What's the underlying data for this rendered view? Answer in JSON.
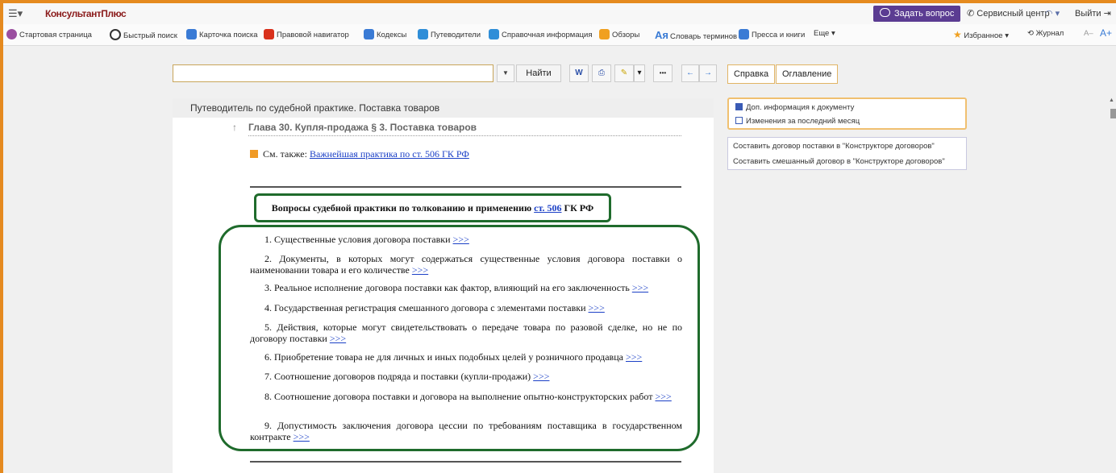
{
  "titlebar": {
    "menu_glyph": "☰▾",
    "brand": "КонсультантПлюс",
    "ask": "Задать вопрос",
    "service": "Сервисный центр",
    "user_caret": "▾",
    "exit": "Выйти"
  },
  "toolbar": {
    "items": [
      {
        "label": "Стартовая страница",
        "icon": "home-icon",
        "color": "#9b4fa0"
      },
      {
        "label": "Быстрый поиск",
        "icon": "search-icon",
        "color": "#333333"
      },
      {
        "label": "Карточка поиска",
        "icon": "search-card-icon",
        "color": "#3a7bd5"
      },
      {
        "label": "Правовой навигатор",
        "icon": "navigator-icon",
        "color": "#d9311c"
      },
      {
        "label": "Кодексы",
        "icon": "codex-icon",
        "color": "#3a7bd5"
      },
      {
        "label": "Путеводители",
        "icon": "signpost-icon",
        "color": "#2f8ed8"
      },
      {
        "label": "Справочная информация",
        "icon": "reference-icon",
        "color": "#2f8ed8"
      },
      {
        "label": "Обзоры",
        "icon": "reviews-icon",
        "color": "#f0a020"
      },
      {
        "label": "Словарь терминов",
        "icon": "dictionary-icon",
        "color": "#3a7bd5"
      },
      {
        "label": "Пресса и книги",
        "icon": "press-icon",
        "color": "#3a7bd5"
      },
      {
        "label": "Еще ▾",
        "icon": "",
        "color": ""
      }
    ],
    "favorites": "Избранное ▾",
    "journal": "Журнал",
    "font_smaller": "A–",
    "font_larger": "A+"
  },
  "search": {
    "value": "",
    "dropdown": "▼",
    "find": "Найти"
  },
  "doc_tools": {
    "word": "W",
    "print": "⎙",
    "marker": "✎",
    "marker_caret": "▾",
    "more": "•••",
    "back": "←",
    "forward": "→"
  },
  "tabs": {
    "help": "Справка",
    "contents": "Оглавление"
  },
  "document": {
    "header": "Путеводитель по судебной практике. Поставка товаров",
    "chapter_arrow": "↑",
    "chapter": "Глава 30. Купля-продажа § 3. Поставка товаров",
    "see_also_prefix": "См. также:",
    "see_also_link": "Важнейшая практика по ст. 506 ГК РФ",
    "questions_title_pre": "Вопросы судебной практики по толкованию и применению",
    "questions_title_link": "ст. 506",
    "questions_title_post": "ГК РФ",
    "more_link": ">>>",
    "questions": [
      "1. Существенные условия договора поставки",
      "2. Документы, в которых могут содержаться существенные условия договора поставки о наименовании товара и его количестве",
      "3. Реальное исполнение договора поставки как фактор, влияющий на его заключенность",
      "4. Государственная регистрация смешанного договора с элементами поставки",
      "5. Действия, которые могут свидетельствовать о передаче товара по разовой сделке, но не по договору поставки",
      "6. Приобретение товара не для личных и иных подобных целей у розничного продавца",
      "7. Соотношение договоров подряда и поставки (купли-продажи)",
      "8. Соотношение договора поставки и договора на выполнение опытно-конструкторских работ",
      "9. Допустимость заключения договора цессии по требованиям поставщика в государственном контракте"
    ]
  },
  "side": {
    "extra_info": "Доп. информация к документу",
    "changes": "Изменения за последний месяц",
    "construct_supply": "Составить договор поставки в \"Конструкторе договоров\"",
    "construct_mixed": "Составить смешанный договор в \"Конструкторе договоров\""
  },
  "colors": {
    "frame": "#e58a1f",
    "highlight": "#1f6b2c",
    "link": "#1a3fc6",
    "ask_button": "#5b3c92"
  }
}
